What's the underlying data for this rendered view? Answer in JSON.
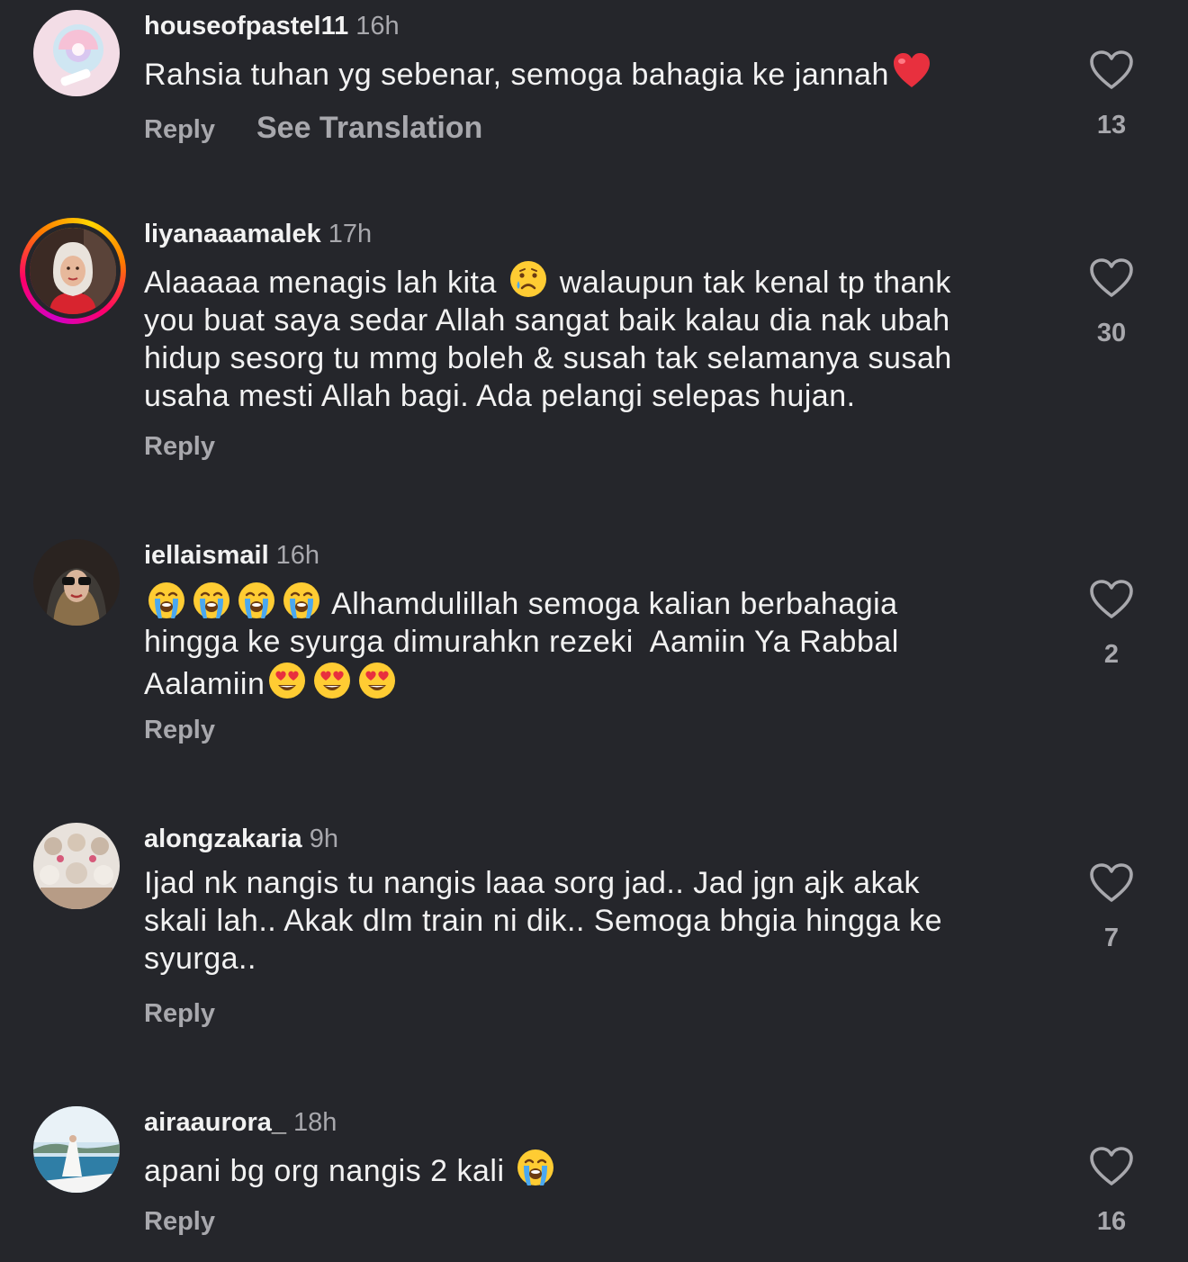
{
  "comments": [
    {
      "username": "houseofpastel11",
      "time": "16h",
      "text_parts": [
        "Rahsia tuhan yg sebenar, semoga bahagia ke jannah"
      ],
      "reply": "Reply",
      "see_translation": "See Translation",
      "likes": "13",
      "avatar_icon": "lollipop-avatar"
    },
    {
      "username": "liyanaaamalek",
      "time": "17h",
      "text_parts": [
        "Alaaaaa menagis lah kita ",
        " walaupun tak kenal tp thank\nyou buat saya sedar Allah sangat baik kalau dia nak ubah\nhidup sesorg tu mmg boleh & susah tak selamanya susah\nusaha mesti Allah bagi. Ada pelangi selepas hujan."
      ],
      "reply": "Reply",
      "likes": "30",
      "avatar_icon": "woman-hijab-avatar"
    },
    {
      "username": "iellaismail",
      "time": "16h",
      "text_parts": [
        " Alhamdulillah semoga kalian berbahagia\nhingga ke syurga dimurahkn rezeki  Aamiin Ya Rabbal\nAalamiin"
      ],
      "reply": "Reply",
      "likes": "2",
      "avatar_icon": "woman-sunglasses-avatar"
    },
    {
      "username": "alongzakaria",
      "time": "9h",
      "text_parts": [
        "Ijad nk nangis tu nangis laaa sorg jad.. Jad jgn ajk akak\nskali lah.. Akak dlm train ni dik.. Semoga bhgia hingga ke\nsyurga.."
      ],
      "reply": "Reply",
      "likes": "7",
      "avatar_icon": "group-photo-avatar"
    },
    {
      "username": "airaaurora_",
      "time": "18h",
      "text_parts": [
        "apani bg org nangis 2 kali "
      ],
      "reply": "Reply",
      "likes": "16",
      "avatar_icon": "sea-view-avatar"
    }
  ],
  "colors": {
    "background": "#25262b",
    "text": "#f2f2f2",
    "muted": "#a8a8ad"
  },
  "icons": {
    "like": "heart-outline-icon",
    "heart_emoji": "red-heart-emoji",
    "sad_emoji": "crying-face-emoji",
    "loud_cry_emoji": "loudly-crying-face-emoji",
    "heart_eyes_emoji": "heart-eyes-emoji"
  }
}
